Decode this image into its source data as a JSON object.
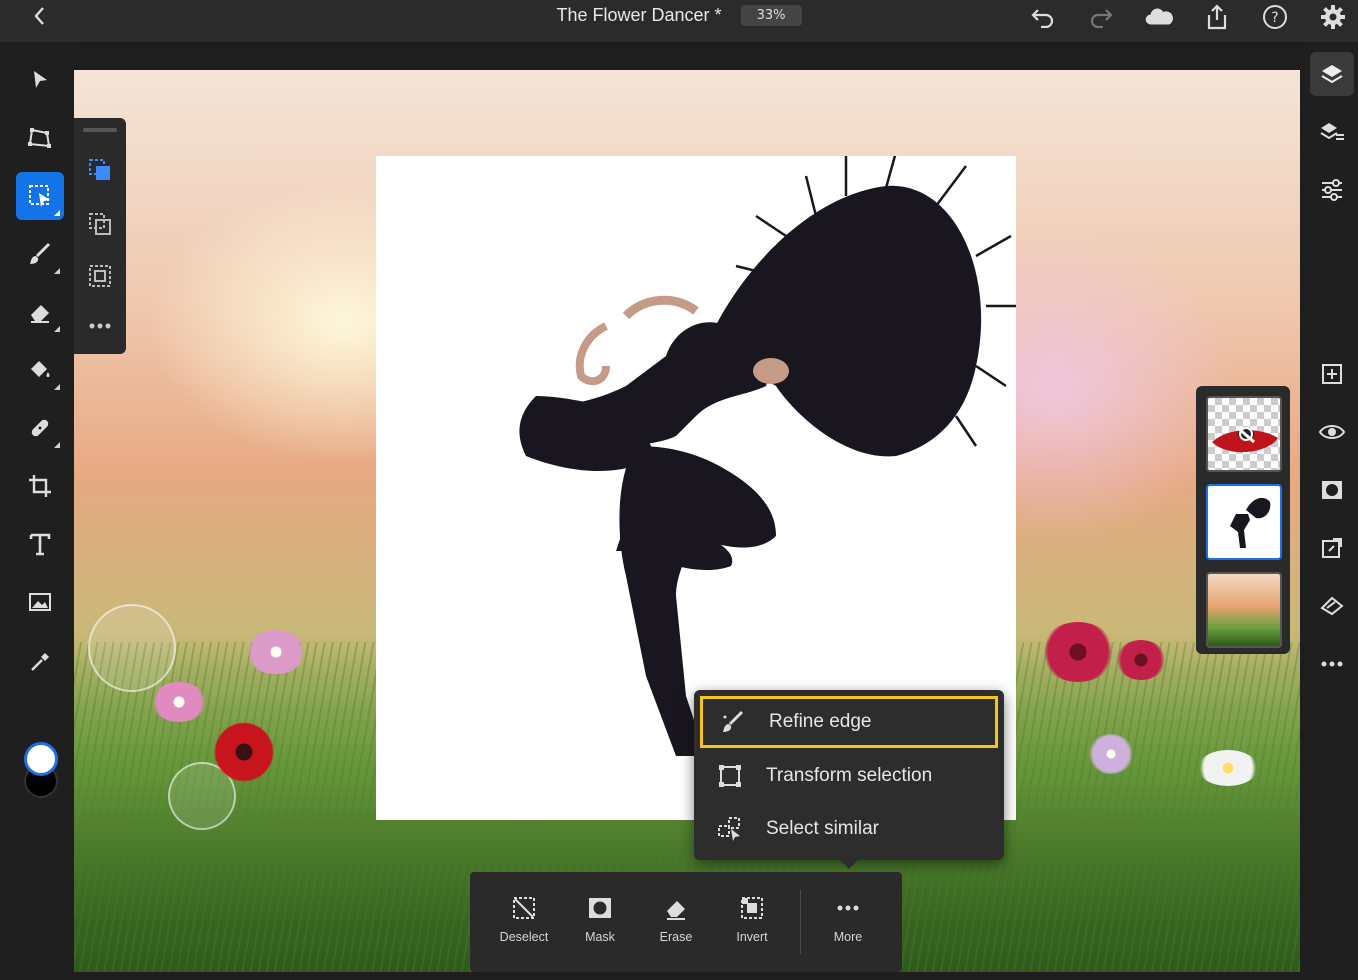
{
  "document": {
    "title": "The Flower Dancer *",
    "zoom": "33%"
  },
  "topbar": {
    "icons": [
      "back-chevron-icon",
      "undo-icon",
      "redo-icon",
      "cloud-icon",
      "share-icon",
      "help-icon",
      "settings-icon"
    ]
  },
  "left_toolbar": {
    "tools": [
      "move",
      "transform",
      "select",
      "brush",
      "eraser",
      "fill",
      "healing",
      "crop",
      "type",
      "place-image",
      "eyedropper"
    ],
    "active_tool": "select",
    "foreground_color": "#ffffff",
    "background_color": "#000000"
  },
  "selection_flyout": {
    "tools": [
      "object-select",
      "lasso-select",
      "subject-select",
      "more"
    ]
  },
  "right_toolbar": {
    "tools": [
      "layers",
      "layer-properties",
      "adjustments",
      "add-layer",
      "visibility",
      "mask",
      "arrange",
      "clear-layer",
      "more"
    ]
  },
  "layers": [
    {
      "name": "flower-layer",
      "selected": false
    },
    {
      "name": "dancer-layer",
      "selected": true
    },
    {
      "name": "background-layer",
      "selected": false
    }
  ],
  "context_menu": {
    "items": [
      {
        "label": "Refine edge",
        "icon": "refine-edge-brush-icon",
        "highlighted": true
      },
      {
        "label": "Transform selection",
        "icon": "transform-selection-icon",
        "highlighted": false
      },
      {
        "label": "Select similar",
        "icon": "select-similar-icon",
        "highlighted": false
      }
    ]
  },
  "bottom_bar": {
    "items": [
      {
        "label": "Deselect",
        "icon": "deselect-icon"
      },
      {
        "label": "Mask",
        "icon": "mask-icon"
      },
      {
        "label": "Erase",
        "icon": "erase-icon"
      },
      {
        "label": "Invert",
        "icon": "invert-icon"
      },
      {
        "label": "More",
        "icon": "more-dots-icon"
      }
    ]
  },
  "colors": {
    "accent": "#1473e6",
    "highlight": "#f5c518",
    "panel": "#2a2a2a"
  }
}
